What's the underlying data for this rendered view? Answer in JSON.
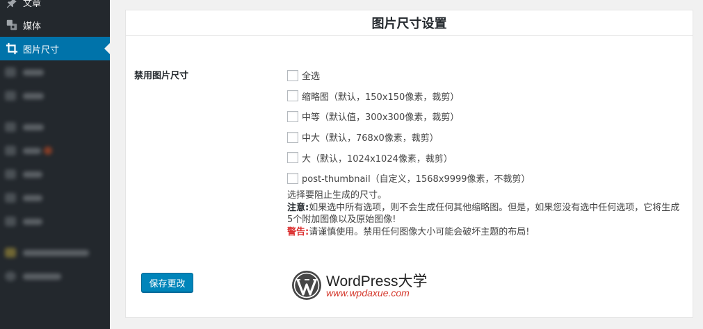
{
  "sidebar": {
    "items": [
      {
        "label": "文章",
        "icon": "pin-icon"
      },
      {
        "label": "媒体",
        "icon": "media-icon"
      },
      {
        "label": "图片尺寸",
        "icon": "crop-icon",
        "active": true
      }
    ]
  },
  "panel": {
    "title": "图片尺寸设置",
    "field_label": "禁用图片尺寸",
    "options": [
      {
        "label": "全选",
        "checked": false
      },
      {
        "label": "缩略图（默认，150x150像素，裁剪）",
        "checked": false
      },
      {
        "label": "中等（默认值，300x300像素，裁剪）",
        "checked": false
      },
      {
        "label": "中大（默认，768x0像素，裁剪）",
        "checked": false
      },
      {
        "label": "大（默认，1024x1024像素，裁剪）",
        "checked": false
      },
      {
        "label": "post-thumbnail（自定义，1568x9999像素，不裁剪）",
        "checked": false
      }
    ],
    "description": "选择要阻止生成的尺寸。",
    "note_label": "注意:",
    "note_text": "如果选中所有选项，则不会生成任何其他缩略图。但是，如果您没有选中任何选项，它将生成5个附加图像以及原始图像!",
    "warning_label": "警告:",
    "warning_text": "请谨慎使用。禁用任何图像大小可能会破坏主题的布局!",
    "save_label": "保存更改"
  },
  "logo": {
    "name": "WordPress大学",
    "url": "www.wpdaxue.com"
  },
  "colors": {
    "sidebar_bg": "#23282d",
    "active_bg": "#0073aa",
    "button_bg": "#0085ba",
    "warning": "#dc3232",
    "logo_url": "#d4382c"
  }
}
